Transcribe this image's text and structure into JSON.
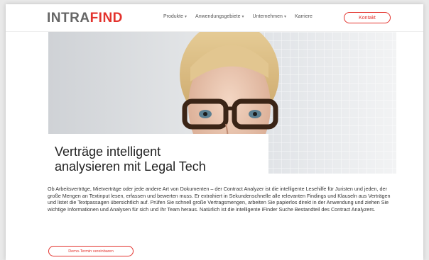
{
  "header": {
    "logo_part1": "INTRA",
    "logo_part2": "FIND",
    "nav": [
      {
        "label": "Produkte",
        "has_dropdown": true
      },
      {
        "label": "Anwendungsgebiete",
        "has_dropdown": true
      },
      {
        "label": "Unternehmen",
        "has_dropdown": true
      },
      {
        "label": "Karriere",
        "has_dropdown": false
      }
    ],
    "cta_label": "Kontakt"
  },
  "hero": {
    "title_line1": "Verträge intelligent",
    "title_line2": "analysieren mit Legal Tech"
  },
  "main": {
    "body": "Ob Arbeitsverträge, Mietverträge oder jede andere Art von Dokumenten – der Contract Analyzer ist die intelligente Lesehilfe für Juristen und jeden, der große Mengen an Textinput lesen, erfassen und bewerten muss. Er extrahiert in Sekundenschnelle alle relevanten Findings und Klauseln aus Verträgen und listet die Textpassagen übersichtlich auf. Prüfen Sie schnell große Vertragsmengen, arbeiten Sie papierlos direkt in der Anwendung und ziehen Sie wichtige Informationen und Analysen für sich und Ihr Team heraus. Natürlich ist die intelligente iFinder Suche Bestandteil des Contract Analyzers.",
    "cta_label": "Demo-Termin vereinbaren"
  },
  "colors": {
    "accent": "#e3322d",
    "logo_gray": "#666666",
    "background": "#ffffff"
  }
}
